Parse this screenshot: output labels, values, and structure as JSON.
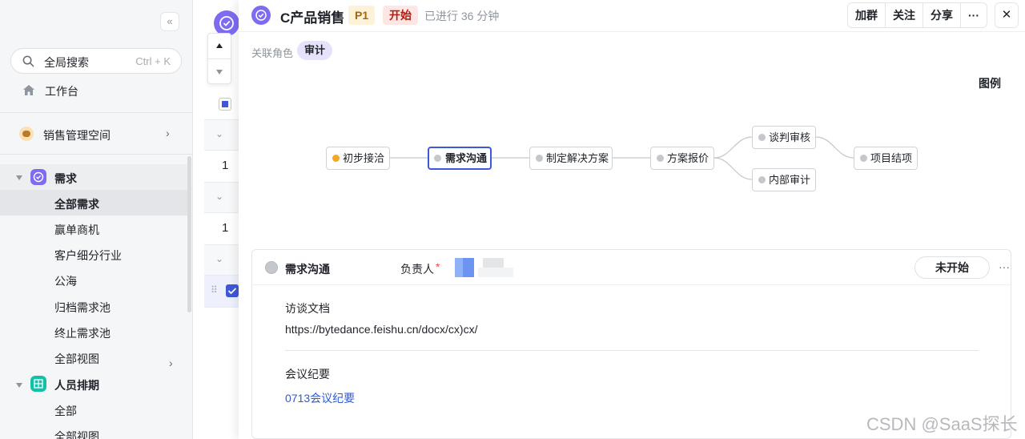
{
  "sidebar": {
    "collapse_icon": "«",
    "search": {
      "placeholder": "全局搜索",
      "shortcut": "Ctrl + K"
    },
    "workbench": "工作台",
    "space": "销售管理空间",
    "groups": [
      {
        "label": "需求",
        "icon": "check-circle-icon",
        "color": "#7d6cf2",
        "items": [
          "全部需求",
          "赢单商机",
          "客户细分行业",
          "公海",
          "归档需求池",
          "终止需求池",
          "全部视图"
        ]
      },
      {
        "label": "人员排期",
        "icon": "table-icon",
        "color": "#14c0a8",
        "items": [
          "全部",
          "全部视图"
        ]
      }
    ]
  },
  "middle": {
    "rows": [
      "1",
      "1"
    ]
  },
  "detail": {
    "title": "C产品销售",
    "priority": "P1",
    "status": "开始",
    "elapsed": "已进行 36 分钟",
    "actions": [
      "加群",
      "关注",
      "分享",
      "···"
    ],
    "close": "✕",
    "role_label": "关联角色",
    "role_tag": "审计",
    "legend": "图例",
    "flow_nodes": [
      "初步接洽",
      "需求沟通",
      "制定解决方案",
      "方案报价",
      "谈判审核",
      "内部审计",
      "项目结项"
    ],
    "task": {
      "name": "需求沟通",
      "owner_label": "负责人",
      "required_mark": "*",
      "status_button": "未开始",
      "more": "···",
      "fields": [
        {
          "label": "访谈文档",
          "value": "https://bytedance.feishu.cn/docx/cx)cx/"
        },
        {
          "label": "会议纪要",
          "value": "0713会议纪要"
        }
      ]
    }
  },
  "watermark": "CSDN @SaaS探长",
  "colors": {
    "accent": "#3e58d8",
    "brand": "#7d6cf2",
    "link": "#2e5bd8"
  }
}
